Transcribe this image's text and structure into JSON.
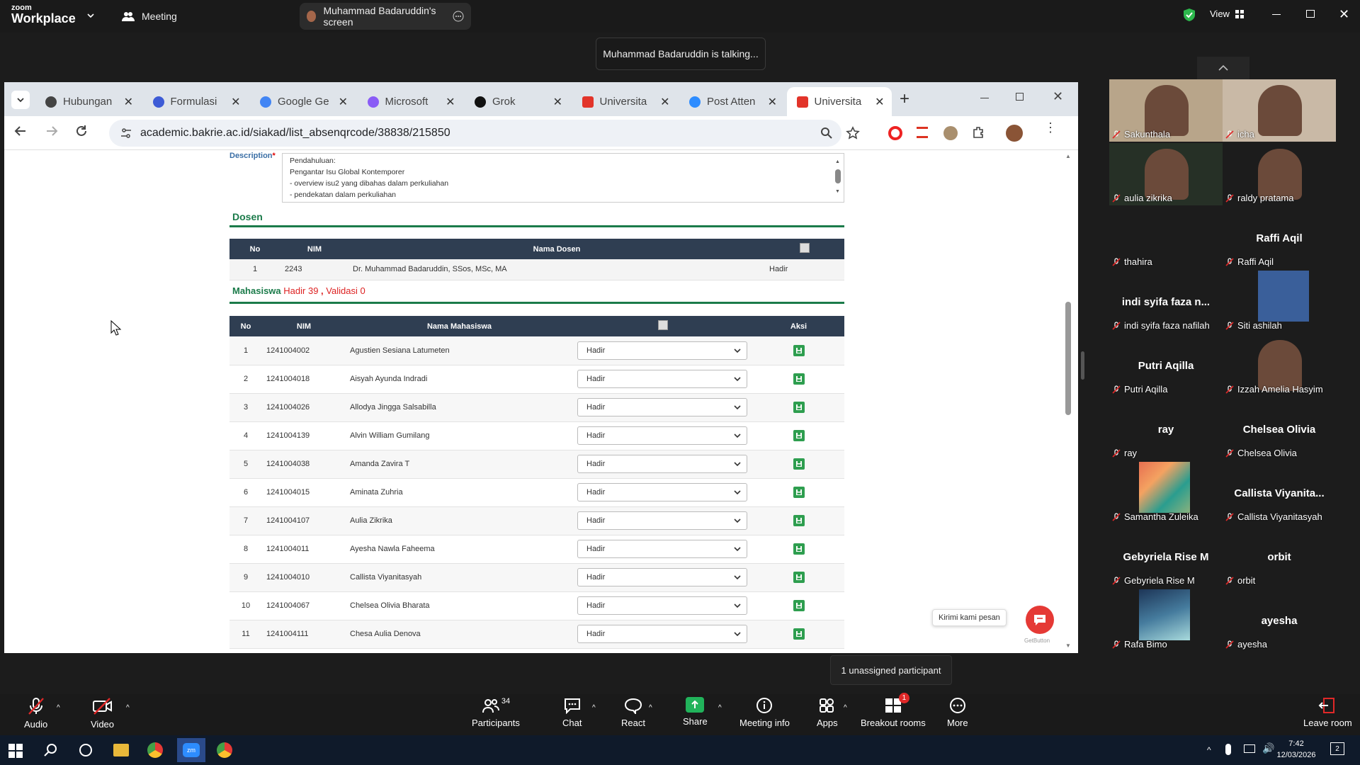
{
  "zoom": {
    "logo_small": "zoom",
    "logo_big": "Workplace",
    "meeting_tab": "Meeting",
    "screen_tab": "Muhammad Badaruddin's screen",
    "view_label": "View",
    "talking": "Muhammad Badaruddin is talking..."
  },
  "browser": {
    "tabs": [
      {
        "label": "Hubungan",
        "icon": "chatgpt-icon"
      },
      {
        "label": "Formulasi",
        "icon": "claude-icon"
      },
      {
        "label": "Google Ge",
        "icon": "gemini-icon"
      },
      {
        "label": "Microsoft",
        "icon": "copilot-icon"
      },
      {
        "label": "Grok",
        "icon": "grok-icon"
      },
      {
        "label": "Universita",
        "icon": "university-shield-icon"
      },
      {
        "label": "Post Atten",
        "icon": "zoom-icon"
      },
      {
        "label": "Universita",
        "icon": "university-shield-icon"
      }
    ],
    "url": "academic.bakrie.ac.id/siakad/list_absenqrcode/38838/215850"
  },
  "form": {
    "description_label": "Description",
    "description_lines": [
      "Pendahuluan:",
      "Pengantar Isu Global Kontemporer",
      "- overview isu2 yang dibahas dalam perkuliahan",
      "- pendekatan dalam perkuliahan"
    ],
    "dosen_title": "Dosen",
    "dosen_headers": [
      "No",
      "NIM",
      "Nama Dosen"
    ],
    "dosen_row": {
      "no": "1",
      "nim": "2243",
      "nama": "Dr. Muhammad Badaruddin, SSos, MSc, MA",
      "status": "Hadir"
    },
    "mhs_title": "Mahasiswa",
    "hadir_text": "Hadir 39",
    "sep": ",",
    "validasi_text": "Validasi 0",
    "mhs_headers": [
      "No",
      "NIM",
      "Nama Mahasiswa",
      "Aksi"
    ],
    "students": [
      {
        "no": "1",
        "nim": "1241004002",
        "nama": "Agustien Sesiana Latumeten",
        "status": "Hadir"
      },
      {
        "no": "2",
        "nim": "1241004018",
        "nama": "Aisyah Ayunda Indradi",
        "status": "Hadir"
      },
      {
        "no": "3",
        "nim": "1241004026",
        "nama": "Allodya Jingga Salsabilla",
        "status": "Hadir"
      },
      {
        "no": "4",
        "nim": "1241004139",
        "nama": "Alvin William Gumilang",
        "status": "Hadir"
      },
      {
        "no": "5",
        "nim": "1241004038",
        "nama": "Amanda Zavira T",
        "status": "Hadir"
      },
      {
        "no": "6",
        "nim": "1241004015",
        "nama": "Aminata Zuhria",
        "status": "Hadir"
      },
      {
        "no": "7",
        "nim": "1241004107",
        "nama": "Aulia Zikrika",
        "status": "Hadir"
      },
      {
        "no": "8",
        "nim": "1241004011",
        "nama": "Ayesha Nawla Faheema",
        "status": "Hadir"
      },
      {
        "no": "9",
        "nim": "1241004010",
        "nama": "Callista Viyanitasyah",
        "status": "Hadir"
      },
      {
        "no": "10",
        "nim": "1241004067",
        "nama": "Chelsea Olivia Bharata",
        "status": "Hadir"
      },
      {
        "no": "11",
        "nim": "1241004111",
        "nama": "Chesa Aulia Denova",
        "status": "Hadir"
      }
    ],
    "chat_bubble": "Kirimi kami pesan",
    "getbutton": "GetButton"
  },
  "participants": [
    {
      "name": "Sakunthala",
      "big": "",
      "bg": "#b8a58a"
    },
    {
      "name": "icha",
      "big": "",
      "bg": "#c9b9a6"
    },
    {
      "name": "aulia zikrika",
      "big": "",
      "bg": "#263026"
    },
    {
      "name": "raldy pratama",
      "big": "",
      "bg": "#1c1c1c"
    },
    {
      "name": "thahira",
      "big": "",
      "bg": "#1c1c1c"
    },
    {
      "name": "Raffi Aqil",
      "big": "Raffi Aqil",
      "bg": "#1c1c1c"
    },
    {
      "name": "indi syifa faza nafilah",
      "big": "indi syifa faza n...",
      "bg": "#1c1c1c"
    },
    {
      "name": "Siti ashilah",
      "big": "",
      "bg": "#1c1c1c"
    },
    {
      "name": "Putri Aqilla",
      "big": "Putri Aqilla",
      "bg": "#1c1c1c"
    },
    {
      "name": "Izzah Amelia Hasyim",
      "big": "",
      "bg": "#1c1c1c"
    },
    {
      "name": "ray",
      "big": "ray",
      "bg": "#1c1c1c"
    },
    {
      "name": "Chelsea Olivia",
      "big": "Chelsea Olivia",
      "bg": "#1c1c1c"
    },
    {
      "name": "Samantha Zuleika",
      "big": "",
      "bg": "#1c1c1c"
    },
    {
      "name": "Callista Viyanitasyah",
      "big": "Callista Viyanita...",
      "bg": "#1c1c1c"
    },
    {
      "name": "Gebyriela Rise M",
      "big": "Gebyriela Rise M",
      "bg": "#1c1c1c"
    },
    {
      "name": "orbit",
      "big": "orbit",
      "bg": "#1c1c1c"
    },
    {
      "name": "Rafa Bimo",
      "big": "",
      "bg": "#1c1c1c"
    },
    {
      "name": "ayesha",
      "big": "ayesha",
      "bg": "#1c1c1c"
    }
  ],
  "toolbar": {
    "audio": "Audio",
    "video": "Video",
    "participants": "Participants",
    "participants_count": "34",
    "chat": "Chat",
    "react": "React",
    "share": "Share",
    "meeting_info": "Meeting info",
    "apps": "Apps",
    "breakout": "Breakout rooms",
    "breakout_badge": "1",
    "more": "More",
    "leave": "Leave room",
    "unassigned": "1 unassigned participant"
  },
  "taskbar": {
    "time": "7:42",
    "date": "12/03/2026",
    "notif": "2"
  }
}
